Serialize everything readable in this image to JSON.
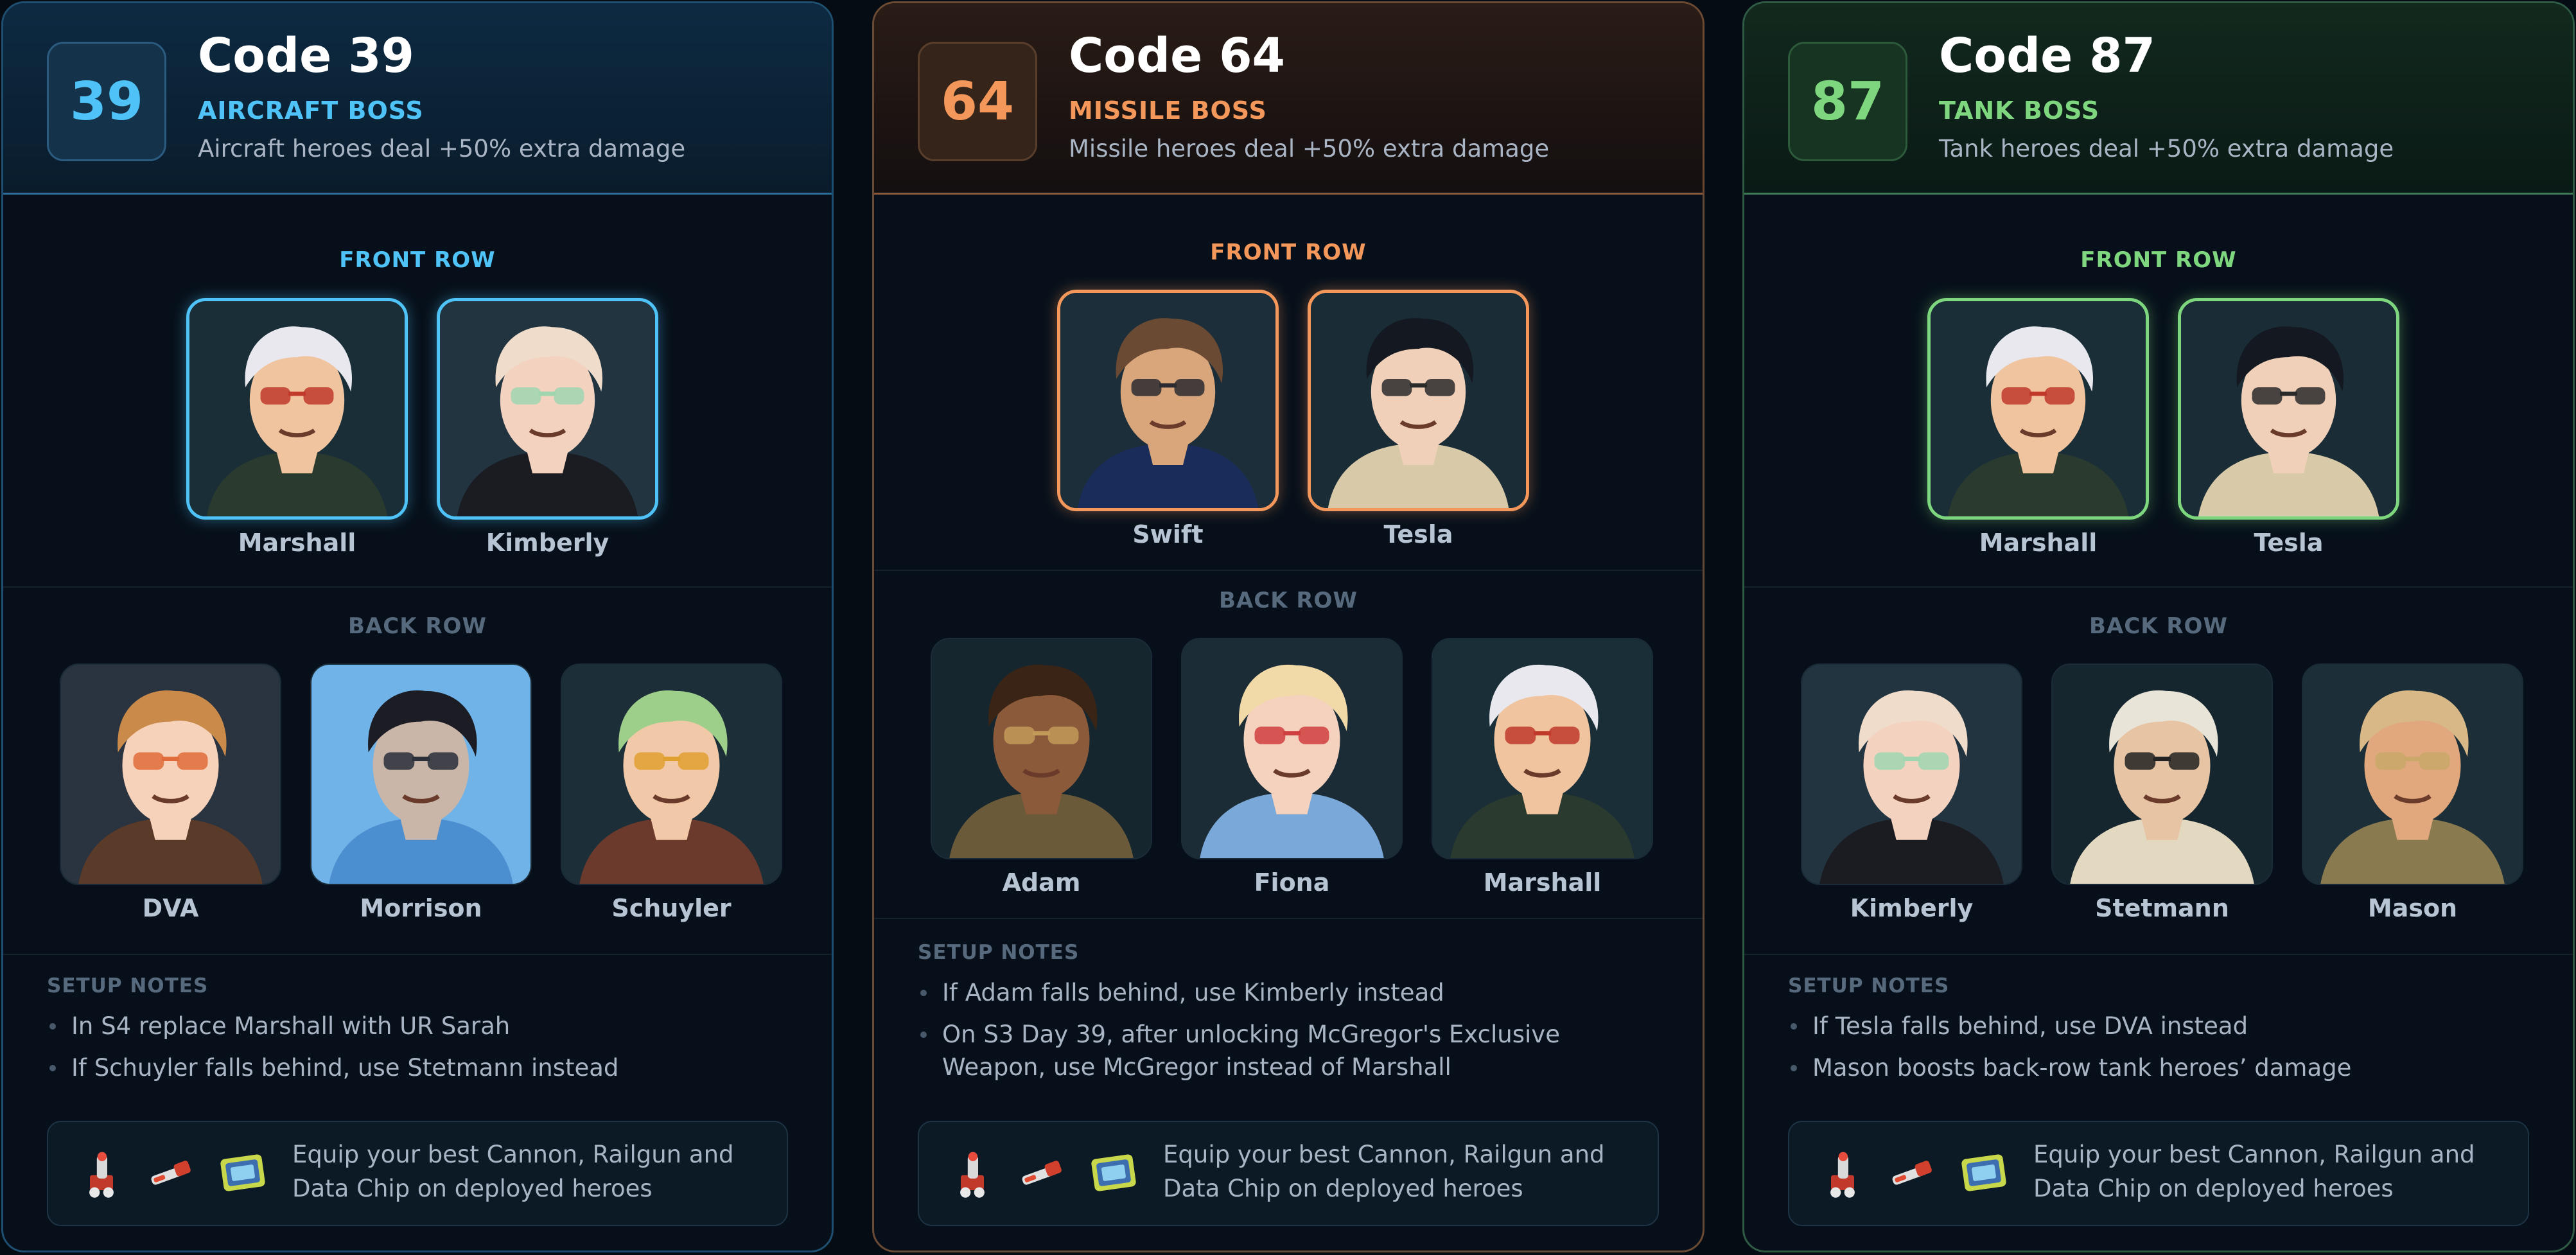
{
  "cards": [
    {
      "badge": "39",
      "title": "Code 39",
      "boss": "AIRCRAFT BOSS",
      "description": "Aircraft heroes deal +50% extra damage",
      "accent": "#4fc3f7",
      "front_label": "FRONT ROW",
      "front": [
        "Marshall",
        "Kimberly"
      ],
      "back_label": "BACK ROW",
      "back": [
        "DVA",
        "Morrison",
        "Schuyler"
      ],
      "notes_title": "SETUP NOTES",
      "notes": [
        "In S4 replace Marshall with UR Sarah",
        "If Schuyler falls behind, use Stetmann instead"
      ],
      "equip_text": "Equip your best Cannon, Railgun and Data Chip on deployed heroes"
    },
    {
      "badge": "64",
      "title": "Code 64",
      "boss": "MISSILE BOSS",
      "description": "Missile heroes deal +50% extra damage",
      "accent": "#f4975a",
      "front_label": "FRONT ROW",
      "front": [
        "Swift",
        "Tesla"
      ],
      "back_label": "BACK ROW",
      "back": [
        "Adam",
        "Fiona",
        "Marshall"
      ],
      "notes_title": "SETUP NOTES",
      "notes": [
        "If Adam falls behind, use Kimberly instead",
        "On S3 Day 39, after unlocking McGregor's Exclusive Weapon, use McGregor instead of Marshall"
      ],
      "equip_text": "Equip your best Cannon, Railgun and Data Chip on deployed heroes"
    },
    {
      "badge": "87",
      "title": "Code 87",
      "boss": "TANK BOSS",
      "description": "Tank heroes deal +50% extra damage",
      "accent": "#7ed67e",
      "front_label": "FRONT ROW",
      "front": [
        "Marshall",
        "Tesla"
      ],
      "back_label": "BACK ROW",
      "back": [
        "Kimberly",
        "Stetmann",
        "Mason"
      ],
      "notes_title": "SETUP NOTES",
      "notes": [
        "If Tesla falls behind, use DVA instead",
        "Mason boosts back-row tank heroes’ damage"
      ],
      "equip_text": "Equip your best Cannon, Railgun and Data Chip on deployed heroes"
    }
  ],
  "equipment_icons": [
    "cannon-icon",
    "railgun-icon",
    "data-chip-icon"
  ],
  "colors": {
    "background": "#050c14",
    "card": "#07101a",
    "aircraft": "#4fc3f7",
    "missile": "#f4975a",
    "tank": "#7ed67e",
    "muted_text": "#a9b5c4"
  }
}
